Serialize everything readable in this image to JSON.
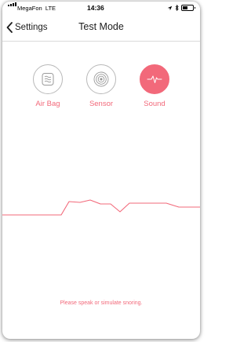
{
  "status_bar": {
    "carrier": "MegaFon",
    "network": "LTE",
    "time": "14:36"
  },
  "navbar": {
    "back_label": "Settings",
    "title": "Test Mode"
  },
  "modes": [
    {
      "label": "Air Bag",
      "icon": "air-bag-icon",
      "active": false
    },
    {
      "label": "Sensor",
      "icon": "sensor-icon",
      "active": false
    },
    {
      "label": "Sound",
      "icon": "sound-wave-icon",
      "active": true
    }
  ],
  "hint": "Please speak or simulate snoring.",
  "colors": {
    "accent": "#f2697a",
    "icon_gray": "#9a9a9a",
    "text": "#1c1c1c"
  }
}
